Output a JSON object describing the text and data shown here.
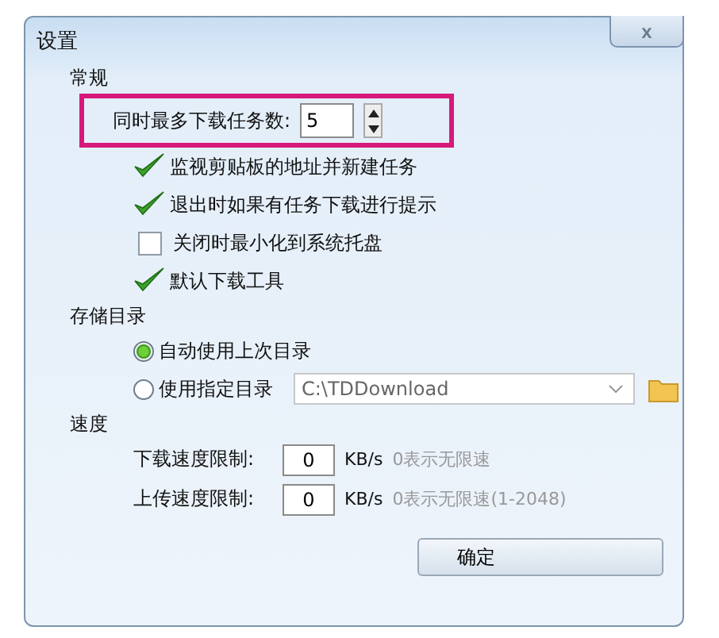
{
  "window": {
    "title": "设置",
    "close_icon": "x"
  },
  "general": {
    "heading": "常规",
    "max_tasks": {
      "label": "同时最多下载任务数:",
      "value": "5",
      "highlighted": true
    },
    "options": [
      {
        "label": "监视剪贴板的地址并新建任务",
        "checked": true
      },
      {
        "label": "退出时如果有任务下载进行提示",
        "checked": true
      },
      {
        "label": "关闭时最小化到系统托盘",
        "checked": false
      },
      {
        "label": "默认下载工具",
        "checked": true
      }
    ]
  },
  "storage": {
    "heading": "存储目录",
    "choices": [
      {
        "label": "自动使用上次目录",
        "selected": true
      },
      {
        "label": "使用指定目录",
        "selected": false
      }
    ],
    "path": "C:\\TDDownload"
  },
  "speed": {
    "heading": "速度",
    "limits": [
      {
        "label": "下载速度限制:",
        "value": "0",
        "unit": "KB/s",
        "hint": "0表示无限速"
      },
      {
        "label": "上传速度限制:",
        "value": "0",
        "unit": "KB/s",
        "hint": "0表示无限速(1-2048)"
      }
    ]
  },
  "buttons": [
    "确定"
  ]
}
